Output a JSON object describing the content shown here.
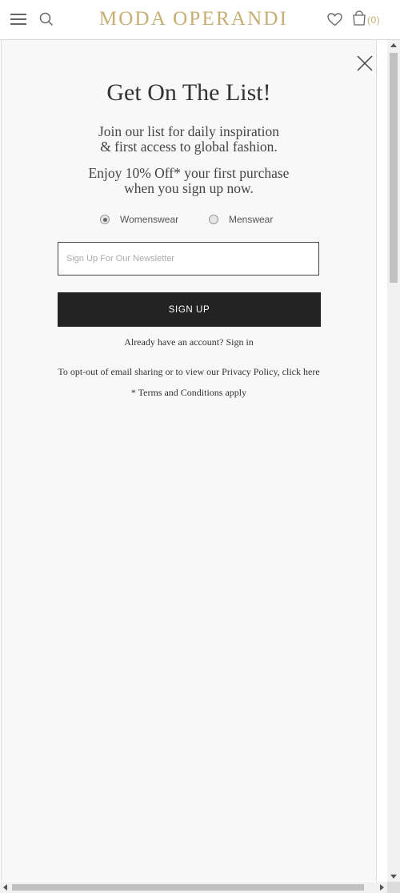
{
  "header": {
    "logo": "MODA OPERANDI",
    "bag_count": "(0)",
    "brand_color": "#c6ad73"
  },
  "icons": {
    "menu": "hamburger-menu-icon",
    "search": "search-icon",
    "wishlist": "heart-icon",
    "bag": "shopping-bag-icon",
    "close": "close-icon"
  },
  "modal": {
    "title": "Get On The List!",
    "intro_line1": "Join our list for daily inspiration",
    "intro_line2": "& first access to global fashion.",
    "offer_line1": "Enjoy 10% Off* your first purchase",
    "offer_line2": "when you sign up now.",
    "gender_options": [
      {
        "label": "Womenswear",
        "checked": true
      },
      {
        "label": "Menswear",
        "checked": false
      }
    ],
    "email_placeholder": "Sign Up For Our Newsletter",
    "email_value": "",
    "signup_label": "SIGN UP",
    "already_text": "Already have an account?",
    "sign_in_link": "Sign in",
    "optout_text": "To opt-out of email sharing or to view our",
    "privacy_link": "Privacy Policy, click here",
    "terms_text": "* Terms and Conditions apply",
    "button_color": "#232323"
  }
}
